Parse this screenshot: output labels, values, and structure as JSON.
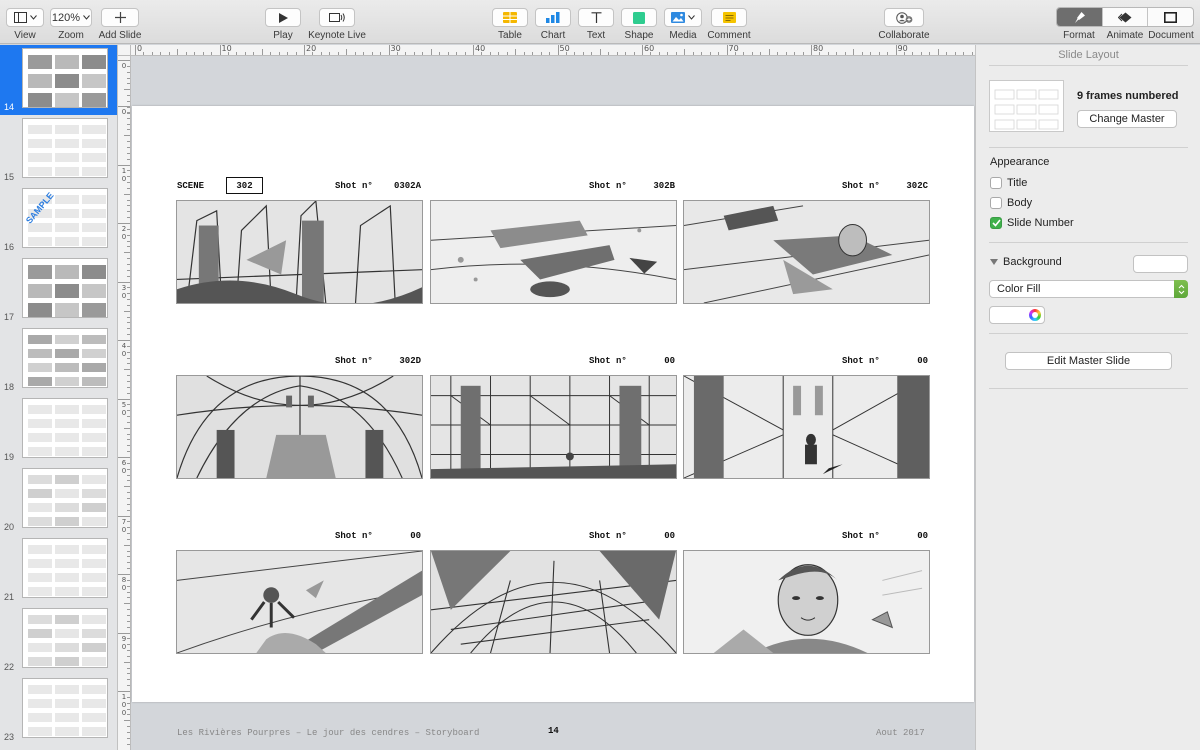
{
  "toolbar": {
    "view": {
      "label": "View",
      "icon": "sidebar-icon"
    },
    "zoom": {
      "label": "Zoom",
      "value": "120%"
    },
    "add_slide": {
      "label": "Add Slide",
      "icon": "plus-icon"
    },
    "play": {
      "label": "Play",
      "icon": "play-icon"
    },
    "keynote_live": {
      "label": "Keynote Live",
      "icon": "keynote-live-icon"
    },
    "table": {
      "label": "Table",
      "icon": "table-icon",
      "color": "#f5b700"
    },
    "chart": {
      "label": "Chart",
      "icon": "chart-icon",
      "color": "#1e88e5"
    },
    "text": {
      "label": "Text",
      "icon": "text-icon"
    },
    "shape": {
      "label": "Shape",
      "icon": "shape-icon",
      "color": "#2ecc8f"
    },
    "media": {
      "label": "Media",
      "icon": "media-icon",
      "color": "#2f8ae0"
    },
    "comment": {
      "label": "Comment",
      "icon": "comment-icon",
      "color": "#f5c400"
    },
    "collaborate": {
      "label": "Collaborate",
      "icon": "collaborate-icon"
    },
    "format": {
      "label": "Format",
      "icon": "paintbrush-icon"
    },
    "animate": {
      "label": "Animate",
      "icon": "animate-icon"
    },
    "document": {
      "label": "Document",
      "icon": "document-icon"
    }
  },
  "navigator": {
    "selected_color": "#1e78f0",
    "slides": [
      {
        "number": "14",
        "selected": true
      },
      {
        "number": "15",
        "selected": false
      },
      {
        "number": "16",
        "selected": false,
        "stamp": "SAMPLE"
      },
      {
        "number": "17",
        "selected": false
      },
      {
        "number": "18",
        "selected": false
      },
      {
        "number": "19",
        "selected": false
      },
      {
        "number": "20",
        "selected": false
      },
      {
        "number": "21",
        "selected": false
      },
      {
        "number": "22",
        "selected": false
      },
      {
        "number": "23",
        "selected": false
      }
    ]
  },
  "rulers": {
    "horizontal": [
      "0",
      "10",
      "20",
      "30",
      "40",
      "50",
      "60",
      "70",
      "80",
      "90"
    ],
    "vertical": [
      "0",
      "0",
      "1 0",
      "2 0",
      "3 0",
      "4 0",
      "5 0",
      "6 0",
      "7 0",
      "8 0",
      "9 0",
      "1 0 0"
    ]
  },
  "slide": {
    "scene_label": "SCENE",
    "scene_number": "302",
    "shot_prefix": "Shot n°",
    "shots": [
      {
        "number": "0302A",
        "subject": "cathedral-debris"
      },
      {
        "number": "302B",
        "subject": "body-on-floor-legs"
      },
      {
        "number": "302C",
        "subject": "man-lying-face-up"
      },
      {
        "number": "302D",
        "subject": "gothic-vault"
      },
      {
        "number": "00",
        "subject": "scaffolding-nave"
      },
      {
        "number": "00",
        "subject": "figure-in-nave"
      },
      {
        "number": "00",
        "subject": "aerial-man-column"
      },
      {
        "number": "00",
        "subject": "ribbed-vault-scaffolding"
      },
      {
        "number": "00",
        "subject": "man-close-up"
      }
    ],
    "footer_title": "Les Rivières Pourpres – Le jour des cendres – Storyboard",
    "footer_page": "14",
    "footer_date": "Aout 2017"
  },
  "inspector": {
    "title": "Slide Layout",
    "master_name": "9 frames numbered",
    "change_master_label": "Change Master",
    "appearance_label": "Appearance",
    "checkboxes": [
      {
        "label": "Title",
        "checked": false
      },
      {
        "label": "Body",
        "checked": false
      },
      {
        "label": "Slide Number",
        "checked": true
      }
    ],
    "background_label": "Background",
    "fill_type": "Color Fill",
    "fill_color": "#ffffff",
    "edit_master_label": "Edit Master Slide",
    "check_color": "#3fb14b"
  }
}
